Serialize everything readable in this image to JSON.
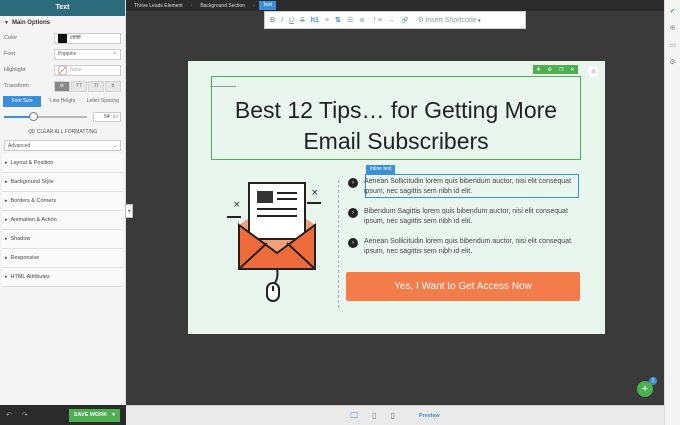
{
  "sidebar": {
    "title": "Text",
    "main_options": "Main Options",
    "color_label": "Color",
    "color_value": "#ffffff",
    "font_label": "Font",
    "font_value": "Poppins",
    "highlight_label": "Highlight",
    "highlight_value": "None",
    "transform_label": "Transform",
    "transform_opts": [
      "TT",
      "Tt",
      "tt"
    ],
    "tabs": [
      "Font Size",
      "Line Height",
      "Letter Spacing"
    ],
    "font_size": "54",
    "font_unit": "px",
    "font_size_level": 0.35,
    "clear_formatting": "CLEAR ALL FORMATTING",
    "advanced": "Advanced",
    "accordions": [
      "Layout & Position",
      "Background Style",
      "Borders & Corners",
      "Animation & Action",
      "Shadow",
      "Responsive",
      "HTML Attributes"
    ],
    "save": "SAVE WORK"
  },
  "breadcrumb": [
    "Thrive Leads Element",
    "Background Section",
    "Text"
  ],
  "toolbar": {
    "buttons": [
      "B",
      "I",
      "U",
      "S",
      "h1",
      "≡",
      "⇅",
      "☰",
      "≣",
      "⋮≡",
      "↔",
      "🔗"
    ],
    "shortcode": "Insert Shortcode"
  },
  "popup": {
    "headline": "Best 12 Tips… for Getting More Email Subscribers",
    "inline_tag": "Inline text",
    "bullets": [
      "Aenean Sollicitudin lorem quis bibendum auctor, nisi elit consequat ipsum, nec sagittis sem nibh id elit.",
      "Bibendum Sagittis lorem quis bibendum auctor, nisi elit consequat ipsum, nec sagittis sem nibh id elit.",
      "Aenean Sollicitudin lorem quis bibendum auctor, nisi elit consequat ipsum, nec sagittis sem nibh id elit."
    ],
    "cta": "Yes, I Want to Get Access Now"
  },
  "bottom": {
    "preview": "Preview",
    "badge": "1"
  },
  "colors": {
    "accent": "#3b8fd8",
    "green": "#4caf50",
    "cta": "#f47c4a",
    "popup_bg": "#e9f6ee"
  }
}
